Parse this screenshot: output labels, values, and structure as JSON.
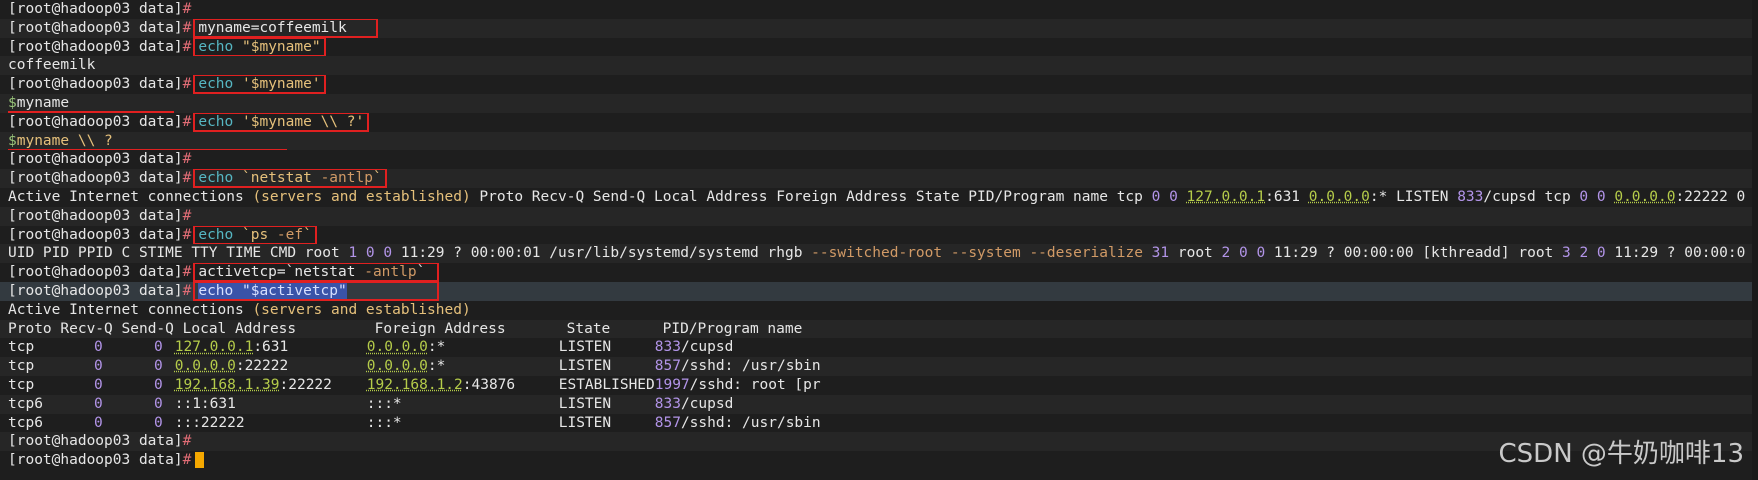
{
  "prompt": {
    "user_host": "[root@hadoop03 data]",
    "hash": "#"
  },
  "commands": {
    "c1": "myname=coffeemilk",
    "c2_echo": "echo",
    "c2_arg": "\"$myname\"",
    "c3_echo": "echo",
    "c3_arg": "'$myname'",
    "c4_echo": "echo",
    "c4_arg": "'$myname \\\\ ?'",
    "c5_echo": "echo",
    "c5_arg_pre": "`netstat ",
    "c5_opt": "-antlp",
    "c5_arg_post": "`",
    "c6_echo": "echo",
    "c6_arg_pre": "`ps ",
    "c6_opt": "-ef",
    "c6_arg_post": "`",
    "c7_pre": "activetcp=`netstat ",
    "c7_opt": "-antlp",
    "c7_post": "`",
    "c8": "echo \"$activetcp\""
  },
  "outputs": {
    "o2": "coffeemilk",
    "o3_dollar": "$",
    "o3_rest": "myname",
    "o4_dollar": "$",
    "o4_rest": "myname \\\\ ?",
    "o5_a": "Active Internet connections ",
    "o5_b": "(servers and established)",
    "o5_c": " Proto Recv-Q Send-Q Local Address Foreign Address State PID/Program name tcp ",
    "o5_n1": "0 0 ",
    "o5_ip1": "127.0.0.1",
    "o5_p1": ":631 ",
    "o5_ip2": "0.0.0.0",
    "o5_p2": ":* LISTEN ",
    "o5_pid": "833",
    "o5_tail": "/cupsd tcp ",
    "o5_n2": "0 0 ",
    "o5_ip3": "0.0.0.0",
    "o5_p3": ":22222 0",
    "o6_a": "UID PID PPID C STIME TTY TIME CMD root ",
    "o6_n1": "1 0 0 ",
    "o6_b": "11:29 ? 00:00:01 /usr/lib/systemd/systemd rhgb ",
    "o6_opt1": "--switched-root",
    "o6_c": " ",
    "o6_opt2": "--system",
    "o6_d": " ",
    "o6_opt3": "--deserialize",
    "o6_e": " ",
    "o6_n2": "31",
    "o6_f": " root ",
    "o6_n3": "2 0 0 ",
    "o6_g": "11:29 ? 00:00:00 [kthreadd] root ",
    "o6_n4": "3 2 0 ",
    "o6_h": "11:29 ? 00:00:0",
    "o8_title": "Active Internet connections ",
    "o8_paren": "(servers and established)"
  },
  "netstat_table": {
    "headers": [
      "Proto",
      "Recv-Q",
      "Send-Q",
      "Local Address",
      "Foreign Address",
      "State",
      "PID/Program name"
    ],
    "rows": [
      {
        "proto": "tcp",
        "recvq": "0",
        "sendq": "0",
        "local_ip": "127.0.0.1",
        "local_port": ":631",
        "foreign_ip": "0.0.0.0",
        "foreign_port": ":*",
        "state": "LISTEN",
        "pid": "833",
        "prog": "/cupsd"
      },
      {
        "proto": "tcp",
        "recvq": "0",
        "sendq": "0",
        "local_ip": "0.0.0.0",
        "local_port": ":22222",
        "foreign_ip": "0.0.0.0",
        "foreign_port": ":*",
        "state": "LISTEN",
        "pid": "857",
        "prog": "/sshd: /usr/sbin"
      },
      {
        "proto": "tcp",
        "recvq": "0",
        "sendq": "0",
        "local_ip": "192.168.1.39",
        "local_port": ":22222",
        "foreign_ip": "192.168.1.2",
        "foreign_port": ":43876",
        "state": "ESTABLISHED",
        "pid": "1997",
        "prog": "/sshd: root [pr"
      },
      {
        "proto": "tcp6",
        "recvq": "0",
        "sendq": "0",
        "local_ip": "",
        "local_port": "::1:631",
        "foreign_ip": "",
        "foreign_port": ":::*",
        "state": "LISTEN",
        "pid": "833",
        "prog": "/cupsd"
      },
      {
        "proto": "tcp6",
        "recvq": "0",
        "sendq": "0",
        "local_ip": "",
        "local_port": ":::22222",
        "foreign_ip": "",
        "foreign_port": ":::*",
        "state": "LISTEN",
        "pid": "857",
        "prog": "/sshd: /usr/sbin"
      }
    ]
  },
  "watermark": "CSDN @牛奶咖啡13",
  "colors": {
    "background": "#1e1e1e",
    "highlight_box": "#e02020",
    "cursor": "#f5a800",
    "prompt_hash": "#e06c75"
  }
}
